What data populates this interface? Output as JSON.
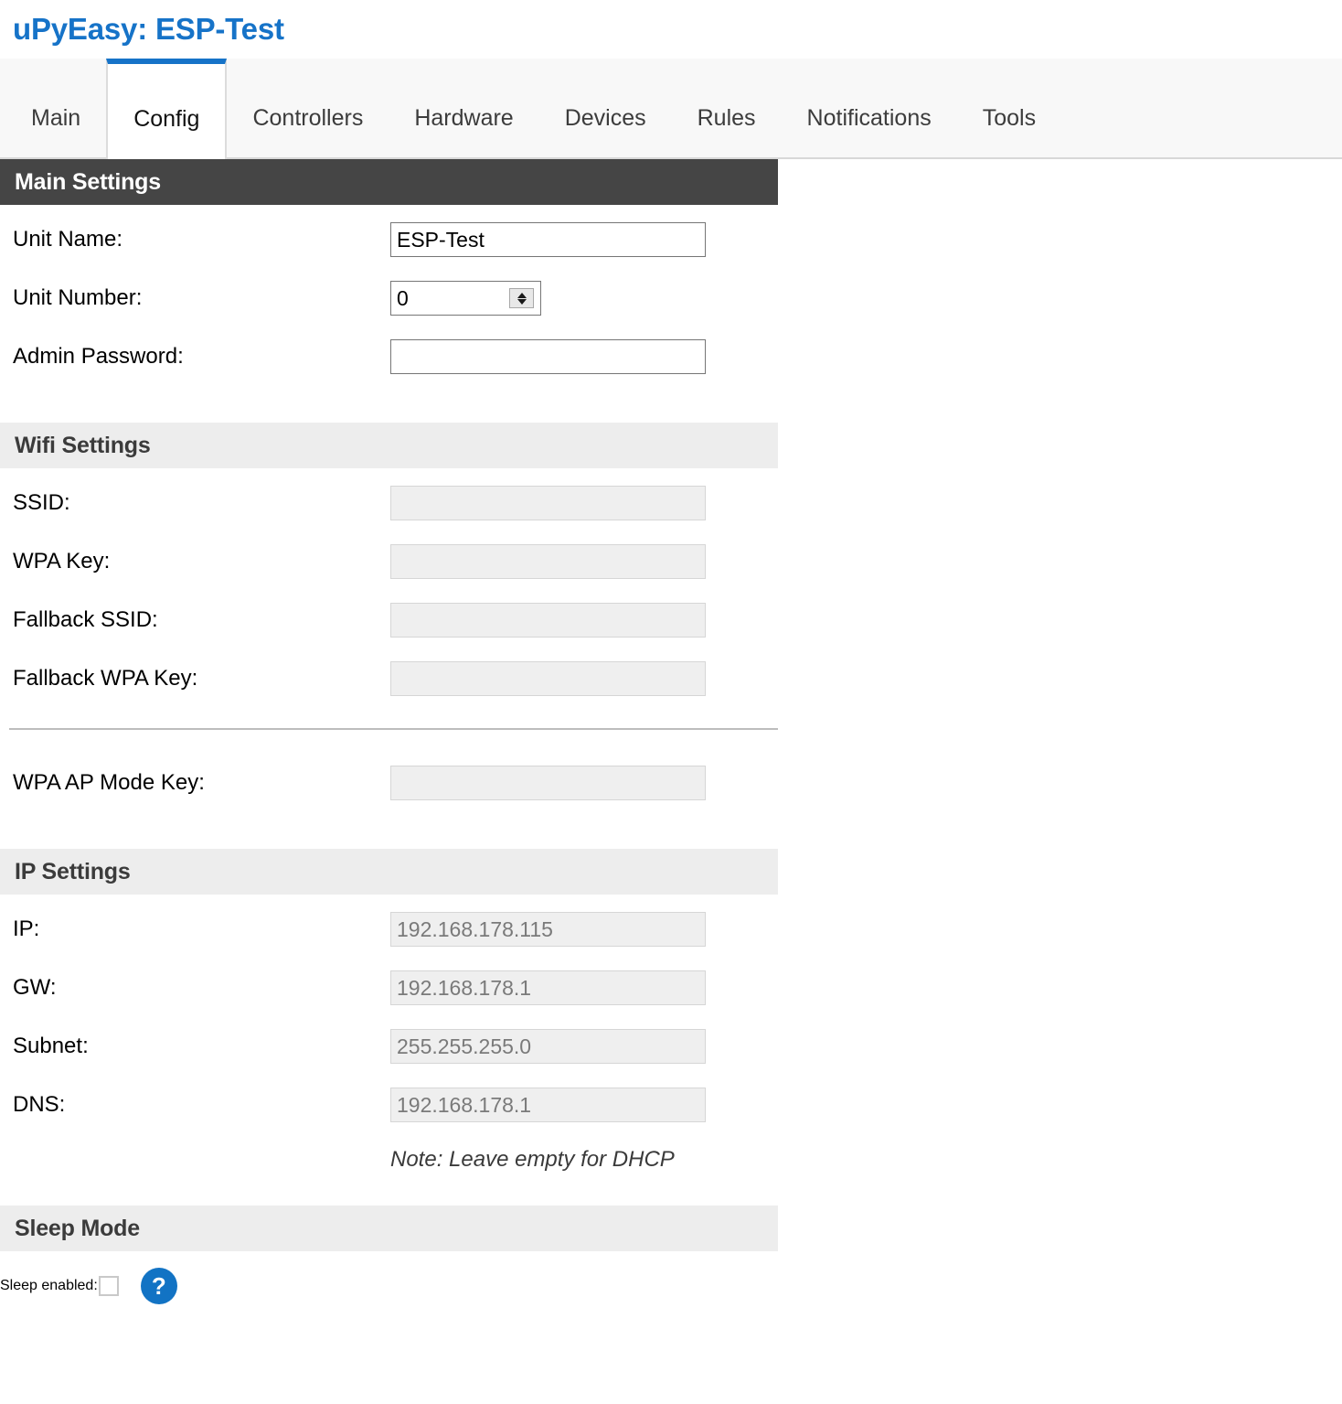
{
  "header": {
    "title": "uPyEasy: ESP-Test"
  },
  "tabs": [
    {
      "label": "Main",
      "active": false
    },
    {
      "label": "Config",
      "active": true
    },
    {
      "label": "Controllers",
      "active": false
    },
    {
      "label": "Hardware",
      "active": false
    },
    {
      "label": "Devices",
      "active": false
    },
    {
      "label": "Rules",
      "active": false
    },
    {
      "label": "Notifications",
      "active": false
    },
    {
      "label": "Tools",
      "active": false
    }
  ],
  "sections": {
    "main": {
      "heading": "Main Settings",
      "fields": {
        "unit_name": {
          "label": "Unit Name:",
          "value": "ESP-Test"
        },
        "unit_number": {
          "label": "Unit Number:",
          "value": "0"
        },
        "admin_password": {
          "label": "Admin Password:",
          "value": ""
        }
      }
    },
    "wifi": {
      "heading": "Wifi Settings",
      "fields": {
        "ssid": {
          "label": "SSID:",
          "value": ""
        },
        "wpa_key": {
          "label": "WPA Key:",
          "value": ""
        },
        "fallback_ssid": {
          "label": "Fallback SSID:",
          "value": ""
        },
        "fallback_wpa_key": {
          "label": "Fallback WPA Key:",
          "value": ""
        },
        "wpa_ap_mode_key": {
          "label": "WPA AP Mode Key:",
          "value": ""
        }
      }
    },
    "ip": {
      "heading": "IP Settings",
      "fields": {
        "ip": {
          "label": "IP:",
          "value": "192.168.178.115"
        },
        "gw": {
          "label": "GW:",
          "value": "192.168.178.1"
        },
        "subnet": {
          "label": "Subnet:",
          "value": "255.255.255.0"
        },
        "dns": {
          "label": "DNS:",
          "value": "192.168.178.1"
        }
      },
      "note": "Note: Leave empty for DHCP"
    },
    "sleep": {
      "heading": "Sleep Mode",
      "fields": {
        "sleep_enabled": {
          "label": "Sleep enabled:",
          "checked": false
        }
      },
      "help_glyph": "?"
    }
  },
  "colors": {
    "accent": "#1673c8",
    "section_dark": "#454545",
    "section_light": "#ededed",
    "help_blue": "#1273c4"
  }
}
